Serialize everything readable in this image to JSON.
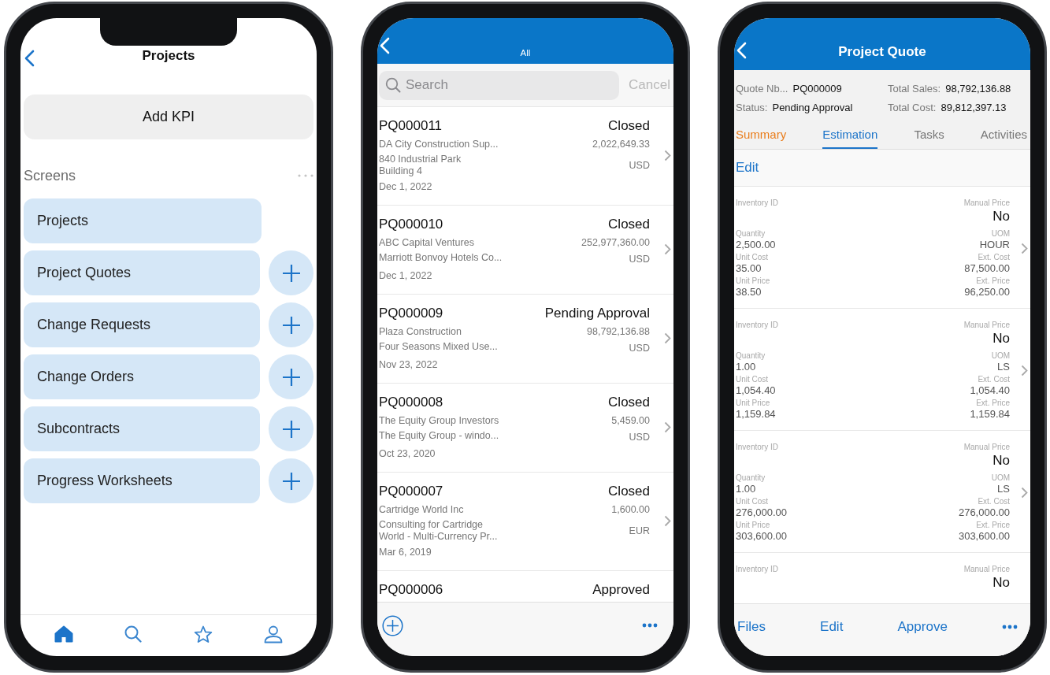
{
  "projects_screen": {
    "title": "Projects",
    "add_button": "Add KPI",
    "section_title": "Screens",
    "tiles": [
      {
        "label": "Projects",
        "has_add": false
      },
      {
        "label": "Project Quotes",
        "has_add": true
      },
      {
        "label": "Change Requests",
        "has_add": true
      },
      {
        "label": "Change Orders",
        "has_add": true
      },
      {
        "label": "Subcontracts",
        "has_add": true
      },
      {
        "label": "Progress Worksheets",
        "has_add": true
      }
    ],
    "tab_bar": [
      {
        "kind": "home",
        "selected": true
      },
      {
        "kind": "search",
        "selected": false
      },
      {
        "kind": "favorites",
        "selected": false
      },
      {
        "kind": "profile",
        "selected": false
      }
    ]
  },
  "quotes_list_screen": {
    "header_title": "All",
    "search": {
      "placeholder": "Search"
    },
    "cancel": "Cancel",
    "rows": [
      {
        "id": "PQ000011",
        "status": "Closed",
        "customer": "DA City Construction Sup...",
        "amount": "2,022,649.33",
        "description": [
          "840 Industrial Park",
          "Building 4"
        ],
        "currency": "USD",
        "date": "Dec 1, 2022"
      },
      {
        "id": "PQ000010",
        "status": "Closed",
        "customer": "ABC Capital Ventures",
        "amount": "252,977,360.00",
        "description": [
          "Marriott Bonvoy Hotels Co..."
        ],
        "currency": "USD",
        "date": "Dec 1, 2022"
      },
      {
        "id": "PQ000009",
        "status": "Pending Approval",
        "customer": "Plaza Construction",
        "amount": "98,792,136.88",
        "description": [
          "Four Seasons Mixed Use..."
        ],
        "currency": "USD",
        "date": "Nov 23, 2022"
      },
      {
        "id": "PQ000008",
        "status": "Closed",
        "customer": "The Equity Group Investors",
        "amount": "5,459.00",
        "description": [
          "The Equity Group - windo..."
        ],
        "currency": "USD",
        "date": "Oct 23, 2020"
      },
      {
        "id": "PQ000007",
        "status": "Closed",
        "customer": "Cartridge World Inc",
        "amount": "1,600.00",
        "description": [
          "Consulting for Cartridge",
          "World - Multi-Currency Pr..."
        ],
        "currency": "EUR",
        "date": "Mar 6, 2019"
      },
      {
        "id": "PQ000006",
        "status": "Approved"
      }
    ]
  },
  "quote_detail_screen": {
    "title": "Project Quote",
    "summary_fields": [
      {
        "label": "Quote Nb...",
        "value": "PQ000009"
      },
      {
        "label": "Total Sales:",
        "value": "98,792,136.88"
      },
      {
        "label": "Status:",
        "value": "Pending Approval"
      },
      {
        "label": "Total Cost:",
        "value": "89,812,397.13"
      }
    ],
    "tabs": [
      {
        "label": "Summary",
        "selected": false,
        "highlighted": true
      },
      {
        "label": "Estimation",
        "selected": true,
        "highlighted": false
      },
      {
        "label": "Tasks",
        "selected": false,
        "highlighted": false
      },
      {
        "label": "Activities",
        "selected": false,
        "highlighted": false
      }
    ],
    "edit_link": "Edit",
    "lines": [
      {
        "inventory_label": "Inventory ID",
        "manual_price": {
          "label": "Manual Price",
          "value": "No"
        },
        "pairs": [
          {
            "left": {
              "label": "Quantity",
              "value": "2,500.00"
            },
            "right": {
              "label": "UOM",
              "value": "HOUR"
            }
          },
          {
            "left": {
              "label": "Unit Cost",
              "value": "35.00"
            },
            "right": {
              "label": "Ext. Cost",
              "value": "87,500.00"
            }
          },
          {
            "left": {
              "label": "Unit Price",
              "value": "38.50"
            },
            "right": {
              "label": "Ext. Price",
              "value": "96,250.00"
            }
          }
        ]
      },
      {
        "inventory_label": "Inventory ID",
        "manual_price": {
          "label": "Manual Price",
          "value": "No"
        },
        "pairs": [
          {
            "left": {
              "label": "Quantity",
              "value": "1.00"
            },
            "right": {
              "label": "UOM",
              "value": "LS"
            }
          },
          {
            "left": {
              "label": "Unit Cost",
              "value": "1,054.40"
            },
            "right": {
              "label": "Ext. Cost",
              "value": "1,054.40"
            }
          },
          {
            "left": {
              "label": "Unit Price",
              "value": "1,159.84"
            },
            "right": {
              "label": "Ext. Price",
              "value": "1,159.84"
            }
          }
        ]
      },
      {
        "inventory_label": "Inventory ID",
        "manual_price": {
          "label": "Manual Price",
          "value": "No"
        },
        "pairs": [
          {
            "left": {
              "label": "Quantity",
              "value": "1.00"
            },
            "right": {
              "label": "UOM",
              "value": "LS"
            }
          },
          {
            "left": {
              "label": "Unit Cost",
              "value": "276,000.00"
            },
            "right": {
              "label": "Ext. Cost",
              "value": "276,000.00"
            }
          },
          {
            "left": {
              "label": "Unit Price",
              "value": "303,600.00"
            },
            "right": {
              "label": "Ext. Price",
              "value": "303,600.00"
            }
          }
        ]
      },
      {
        "inventory_label": "Inventory ID",
        "manual_price": {
          "label": "Manual Price",
          "value": "No"
        }
      }
    ],
    "toolbar_actions": [
      "Files",
      "Edit",
      "Approve"
    ]
  }
}
